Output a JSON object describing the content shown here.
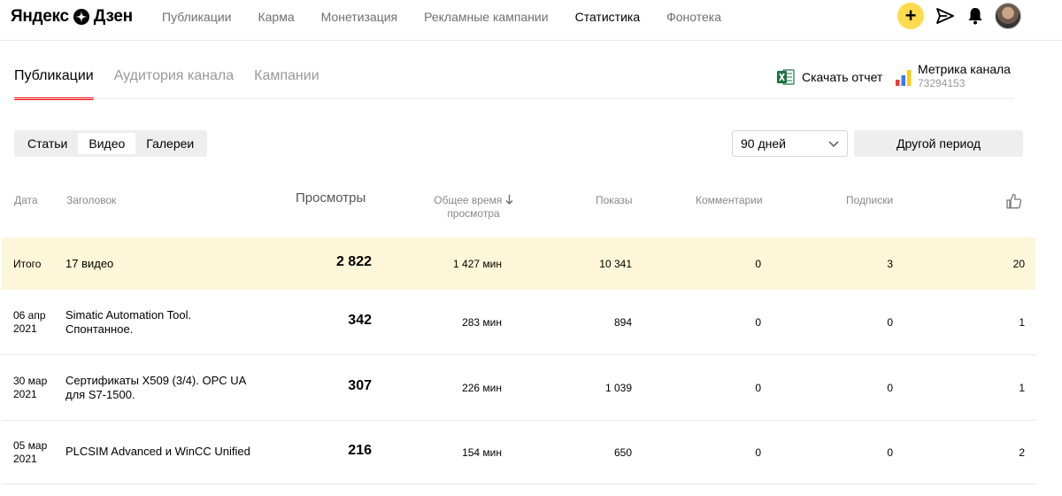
{
  "brand": {
    "logo_text_left": "Яндекс",
    "logo_text_right": "Дзен"
  },
  "nav": [
    {
      "label": "Публикации"
    },
    {
      "label": "Карма"
    },
    {
      "label": "Монетизация"
    },
    {
      "label": "Рекламные кампании"
    },
    {
      "label": "Статистика",
      "active": true
    },
    {
      "label": "Фонотека"
    }
  ],
  "top_actions": {
    "plus_symbol": "+",
    "icons": [
      "plus-icon",
      "send-icon",
      "bell-icon",
      "avatar"
    ],
    "accent_color": "#ffdb4d"
  },
  "tabs": [
    {
      "label": "Публикации",
      "active": true
    },
    {
      "label": "Аудитория канала"
    },
    {
      "label": "Кампании"
    }
  ],
  "tab_accent_color": "#ff0000",
  "report": {
    "download_label": "Скачать отчет",
    "metrika_title": "Метрика канала",
    "metrika_id": "73294153"
  },
  "content_types": [
    {
      "label": "Статьи"
    },
    {
      "label": "Видео",
      "active": true
    },
    {
      "label": "Галереи"
    }
  ],
  "period": {
    "selected": "90 дней",
    "other_label": "Другой период"
  },
  "table": {
    "headers": {
      "date": "Дата",
      "title": "Заголовок",
      "views": "Просмотры",
      "watch_time_line1": "Общее время",
      "watch_time_line2": "просмотра",
      "shows": "Показы",
      "comments": "Комментарии",
      "subscriptions": "Подписки",
      "likes_icon": "thumbs-up-icon"
    },
    "total": {
      "date": "Итого",
      "title": "17 видео",
      "views": "2 822",
      "watch_time": "1 427 мин",
      "shows": "10 341",
      "comments": "0",
      "subscriptions": "3",
      "likes": "20"
    },
    "rows": [
      {
        "date_day": "06 апр",
        "date_year": "2021",
        "title_line1": "Simatic Automation Tool.",
        "title_line2": "Спонтанное.",
        "views": "342",
        "watch_time": "283 мин",
        "shows": "894",
        "comments": "0",
        "subscriptions": "0",
        "likes": "1"
      },
      {
        "date_day": "30 мар",
        "date_year": "2021",
        "title_line1": "Сертификаты X509 (3/4). OPC UA",
        "title_line2": "для S7-1500.",
        "views": "307",
        "watch_time": "226 мин",
        "shows": "1 039",
        "comments": "0",
        "subscriptions": "0",
        "likes": "1"
      },
      {
        "date_day": "05 мар",
        "date_year": "2021",
        "title_line1": "PLCSIM Advanced и WinCC Unified",
        "title_line2": "",
        "views": "216",
        "watch_time": "154 мин",
        "shows": "650",
        "comments": "0",
        "subscriptions": "0",
        "likes": "2"
      }
    ]
  }
}
